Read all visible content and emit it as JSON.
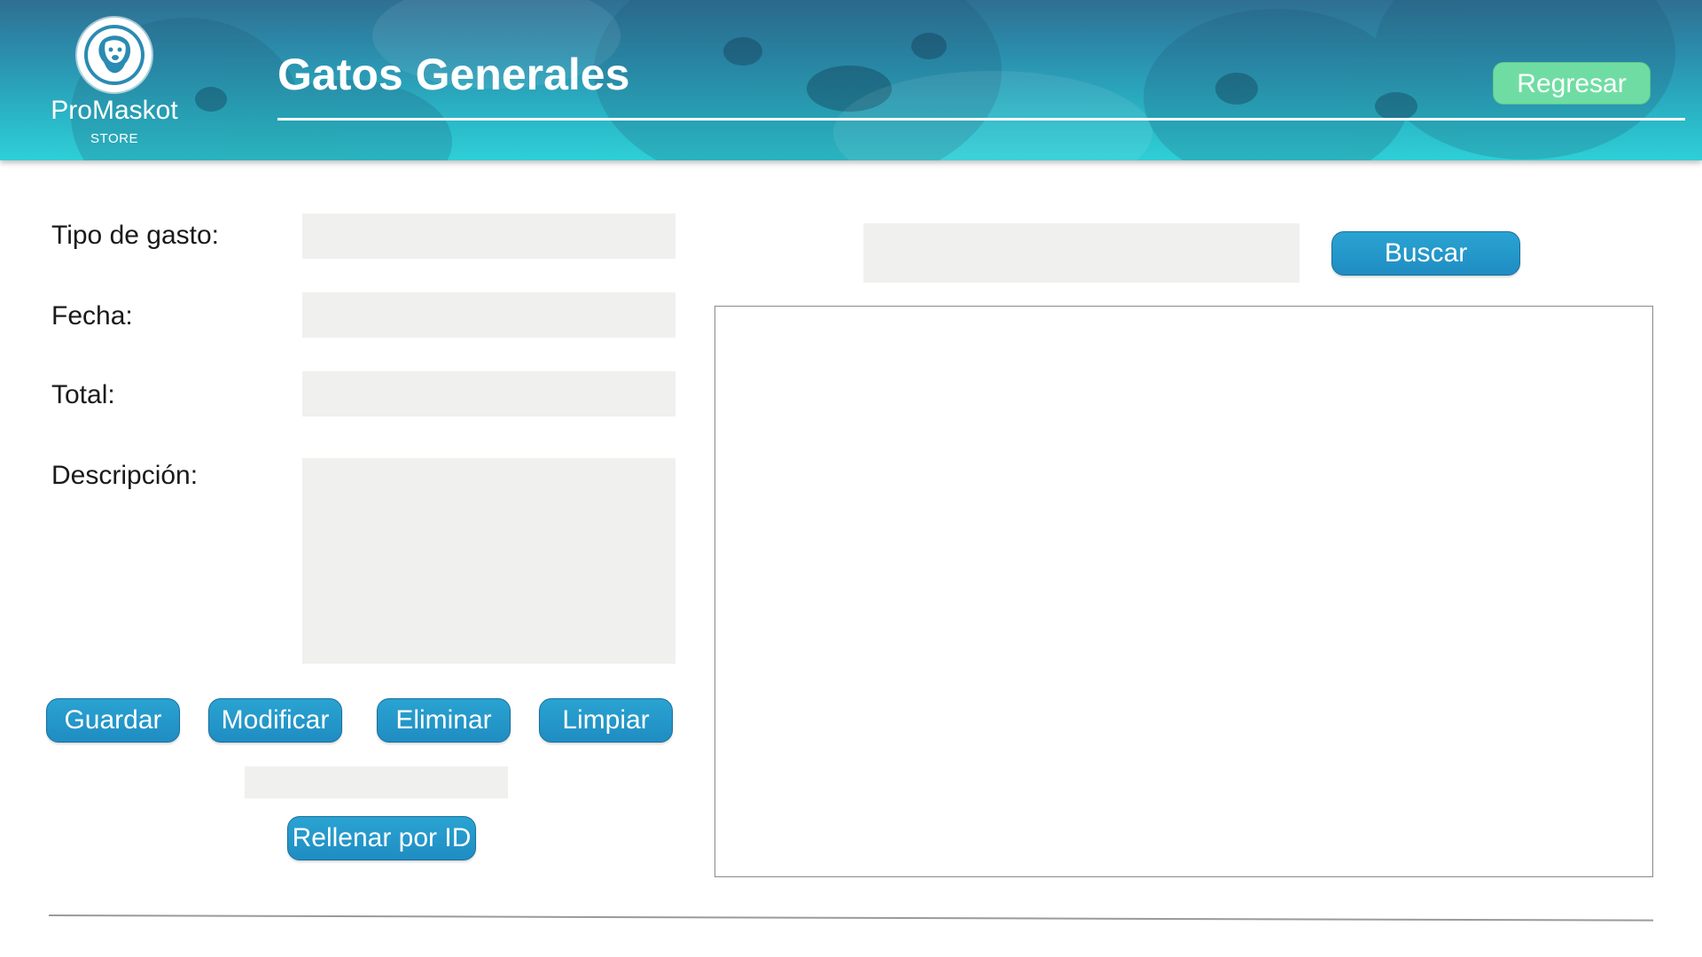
{
  "header": {
    "brand_name": "ProMaskot",
    "brand_sub": "STORE",
    "title": "Gatos Generales",
    "back_button": "Regresar"
  },
  "form": {
    "tipo_label": "Tipo de gasto:",
    "tipo_value": "",
    "fecha_label": "Fecha:",
    "fecha_value": "",
    "total_label": "Total:",
    "total_value": "",
    "descripcion_label": "Descripción:",
    "descripcion_value": ""
  },
  "actions": {
    "guardar": "Guardar",
    "modificar": "Modificar",
    "eliminar": "Eliminar",
    "limpiar": "Limpiar"
  },
  "fill_by_id": {
    "id_value": "",
    "button": "Rellenar por ID"
  },
  "search": {
    "value": "",
    "button": "Buscar"
  },
  "colors": {
    "header_top": "#2f6f92",
    "header_bottom": "#2fcfd6",
    "primary_button": "#2aa3d2",
    "back_button": "#6fdda3",
    "field_bg": "#f0f0ef"
  },
  "icons": {
    "logo": "dog-head-logo-icon"
  }
}
